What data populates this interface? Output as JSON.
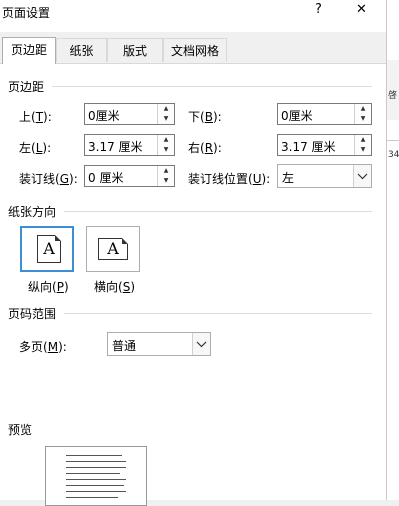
{
  "window": {
    "title": "页面设置",
    "help": "?",
    "close": "✕"
  },
  "right_strip": {
    "text_a": "啓",
    "text_b": "34"
  },
  "tabs": [
    "页边距",
    "纸张",
    "版式",
    "文档网格"
  ],
  "margins": {
    "heading": "页边距",
    "top": {
      "label": "上",
      "key": "T",
      "value": "0厘米"
    },
    "bottom": {
      "label": "下",
      "key": "B",
      "value": "0厘米"
    },
    "left": {
      "label": "左",
      "key": "L",
      "value": "3.17 厘米"
    },
    "right": {
      "label": "右",
      "key": "R",
      "value": "3.17 厘米"
    },
    "gutter": {
      "label": "装订线",
      "key": "G",
      "value": "0 厘米"
    },
    "gutter_pos": {
      "label": "装订线位置",
      "key": "U",
      "value": "左"
    }
  },
  "orientation": {
    "heading": "纸张方向",
    "portrait": {
      "label": "纵向",
      "key": "P"
    },
    "landscape": {
      "label": "横向",
      "key": "S"
    },
    "glyph": "A"
  },
  "pages": {
    "heading": "页码范围",
    "multi": {
      "label": "多页",
      "key": "M",
      "value": "普通"
    }
  },
  "preview": {
    "heading": "预览"
  }
}
